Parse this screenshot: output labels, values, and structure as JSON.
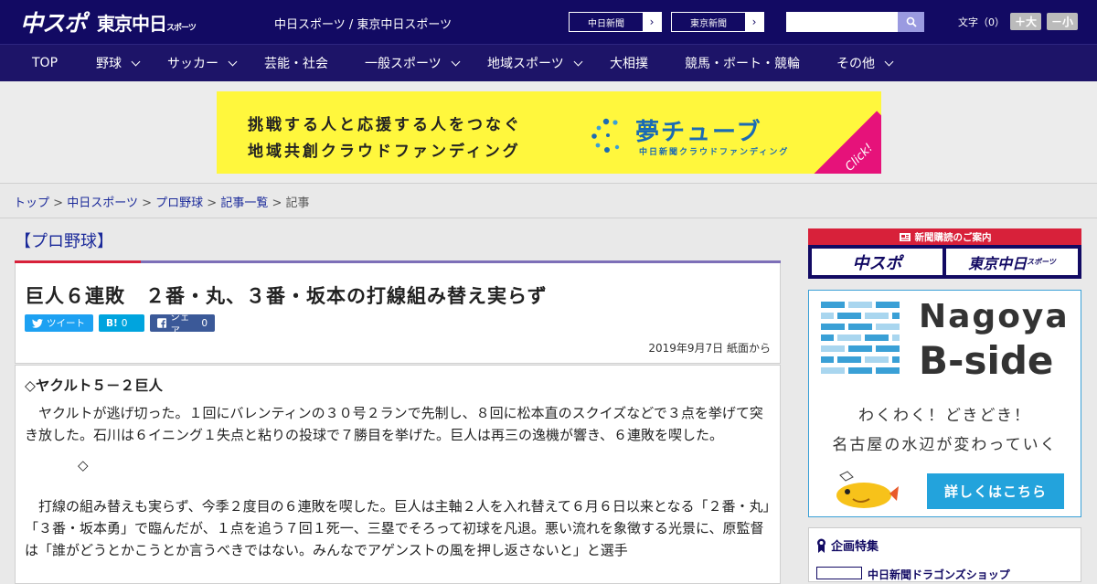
{
  "header": {
    "logo_chunichi": "中スポ",
    "logo_tokyo": "東京中日",
    "logo_tokyo_small": "スポーツ",
    "site_name": "中日スポーツ / 東京中日スポーツ",
    "link_chunichi": "中日新聞",
    "link_tokyo": "東京新聞",
    "search_placeholder": "",
    "font_label": "文字（0）",
    "font_bigger": "＋大",
    "font_smaller": "－小",
    "search_icon": "search-icon",
    "chevron_icon": "chevron-right-icon"
  },
  "nav": {
    "items": [
      {
        "label": "TOP",
        "dropdown": false
      },
      {
        "label": "野球",
        "dropdown": true
      },
      {
        "label": "サッカー",
        "dropdown": true
      },
      {
        "label": "芸能・社会",
        "dropdown": false
      },
      {
        "label": "一般スポーツ",
        "dropdown": true
      },
      {
        "label": "地域スポーツ",
        "dropdown": true
      },
      {
        "label": "大相撲",
        "dropdown": false
      },
      {
        "label": "競馬・ボート・競輪",
        "dropdown": false
      },
      {
        "label": "その他",
        "dropdown": true
      }
    ]
  },
  "banner": {
    "line1": "挑戦する人と応援する人をつなぐ",
    "line2": "地域共創クラウドファンディング",
    "brand": "夢チューブ",
    "brand_sub": "中日新聞クラウドファンディング",
    "click": "Click!",
    "colors": {
      "bg": "#fff73d",
      "brand": "#1b6bb3",
      "accent": "#e6127a"
    }
  },
  "breadcrumb": {
    "items": [
      "トップ",
      "中日スポーツ",
      "プロ野球",
      "記事一覧"
    ],
    "current": "記事",
    "sep": ">"
  },
  "article": {
    "category": "【プロ野球】",
    "title": "巨人６連敗　２番・丸、３番・坂本の打線組み替え実らず",
    "share": {
      "tweet": "ツイート",
      "hatena": "B!",
      "hatena_count": "0",
      "facebook": "シェア",
      "facebook_count": "0"
    },
    "date": "2019年9月7日 紙面から",
    "subhead": "◇ヤクルト５－２巨人",
    "para1": "ヤクルトが逃げ切った。１回にバレンティンの３０号２ランで先制し、８回に松本直のスクイズなどで３点を挙げて突き放した。石川は６イニング１失点と粘りの投球で７勝目を挙げた。巨人は再三の逸機が響き、６連敗を喫した。",
    "diamond": "◇",
    "para2": "打線の組み替えも実らず、今季２度目の６連敗を喫した。巨人は主軸２人を入れ替えて６月６日以来となる「２番・丸」「３番・坂本勇」で臨んだが、１点を追う７回１死一、三塁でそろって初球を凡退。悪い流れを象徴する光景に、原監督は「誰がどうとかこうとか言うべきではない。みんなでアゲンストの風を押し返さないと」と選手"
  },
  "sidebar": {
    "subscribe_title": "新聞購読のご案内",
    "subscribe_chunichi": "中スポ",
    "subscribe_tokyo": "東京中日",
    "subscribe_tokyo_small": "スポーツ",
    "nagoya_line1": "Nagoya",
    "nagoya_line2": "B-side",
    "nagoya_copy1": "わくわく！どきどき！",
    "nagoya_copy2": "名古屋の水辺が変わっていく",
    "nagoya_button": "詳しくはこちら",
    "kikaku_title": "企画特集",
    "kikaku_item": "中日新聞ドラゴンズショップ"
  }
}
